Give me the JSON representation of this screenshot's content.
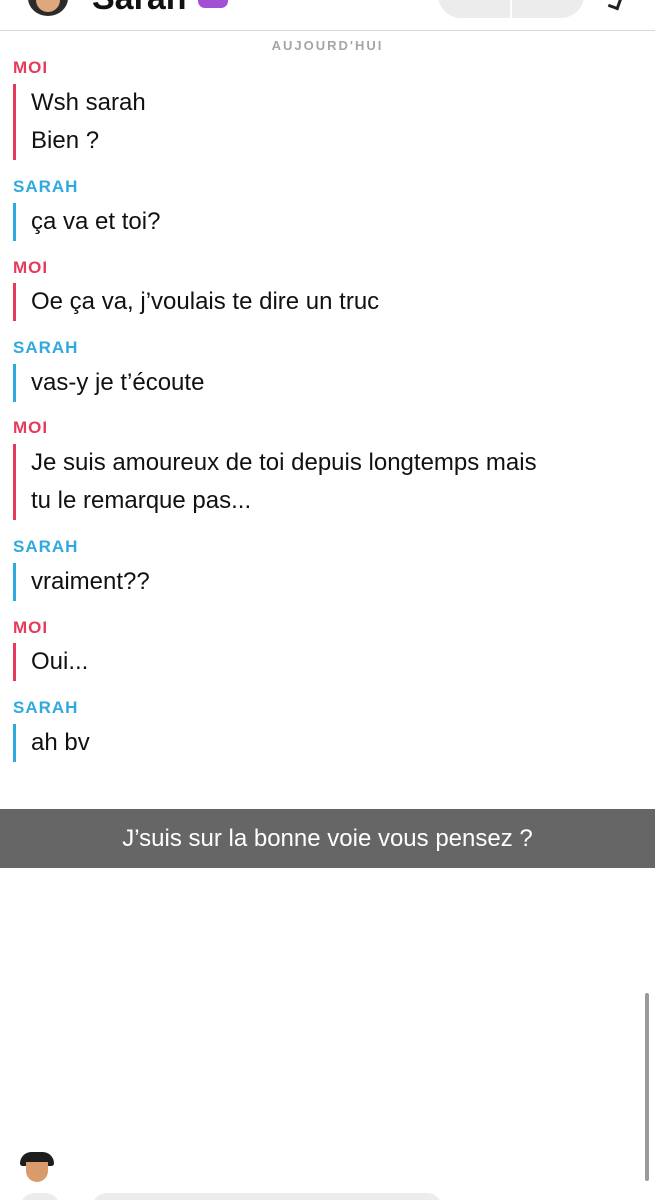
{
  "header": {
    "contact_name": "Sarah"
  },
  "chat": {
    "date_label": "AUJOURD'HUI",
    "messages": [
      {
        "sender": "MOI",
        "lines": [
          "Wsh sarah",
          "Bien ?"
        ]
      },
      {
        "sender": "SARAH",
        "lines": [
          "ça va et toi?"
        ]
      },
      {
        "sender": "MOI",
        "lines": [
          "Oe ça va, j’voulais te dire un truc"
        ]
      },
      {
        "sender": "SARAH",
        "lines": [
          "vas-y je t’écoute"
        ]
      },
      {
        "sender": "MOI",
        "lines": [
          "Je suis amoureux de toi depuis longtemps mais",
          "tu le remarque pas..."
        ]
      },
      {
        "sender": "SARAH",
        "lines": [
          "vraiment??"
        ]
      },
      {
        "sender": "MOI",
        "lines": [
          "Oui..."
        ]
      },
      {
        "sender": "SARAH",
        "lines": [
          "ah bv"
        ]
      }
    ]
  },
  "caption": {
    "text": "J’suis sur la bonne voie vous pensez ?"
  },
  "colors": {
    "me_accent": "#e63a5c",
    "friend_accent": "#2fa9df",
    "caption_bg": "#5a5a5a"
  },
  "icons": {
    "call": "phone-icon",
    "video": "video-camera-icon",
    "more": "chevron-right-icon",
    "bitmoji": "bitmoji-avatar-icon"
  }
}
